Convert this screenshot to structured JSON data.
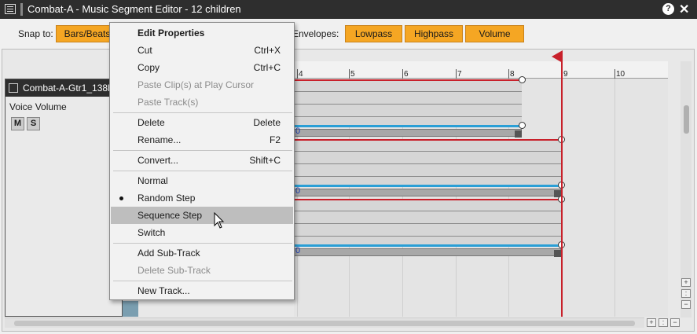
{
  "window": {
    "title": "Combat-A - Music Segment Editor - 12 children"
  },
  "toolbar": {
    "snap_label": "Snap to:",
    "snap_value": "Bars/Beats",
    "envelopes_label": "Envelopes:",
    "lowpass": "Lowpass",
    "highpass": "Highpass",
    "volume": "Volume"
  },
  "track": {
    "name": "Combat-A-Gtr1_138bpm",
    "voice_volume_label": "Voice Volume",
    "mute": "M",
    "solo": "S"
  },
  "ruler": {
    "ticks": [
      "4",
      "5",
      "6",
      "7",
      "8",
      "9",
      "10"
    ]
  },
  "clips": {
    "start_label": "0"
  },
  "context_menu": {
    "edit_properties": "Edit Properties",
    "cut": "Cut",
    "cut_shortcut": "Ctrl+X",
    "copy": "Copy",
    "copy_shortcut": "Ctrl+C",
    "paste_clips": "Paste Clip(s) at Play Cursor",
    "paste_track": "Paste Track(s)",
    "delete": "Delete",
    "delete_shortcut": "Delete",
    "rename": "Rename...",
    "rename_shortcut": "F2",
    "convert": "Convert...",
    "convert_shortcut": "Shift+C",
    "normal": "Normal",
    "random_step": "Random Step",
    "sequence_step": "Sequence Step",
    "switch": "Switch",
    "add_subtrack": "Add Sub-Track",
    "delete_subtrack": "Delete Sub-Track",
    "new_track": "New Track..."
  },
  "colors": {
    "accent": "#f5a623",
    "cursor": "#c8202a",
    "envelope": "#2a9fd6",
    "titlebar": "#2e2e2e"
  }
}
